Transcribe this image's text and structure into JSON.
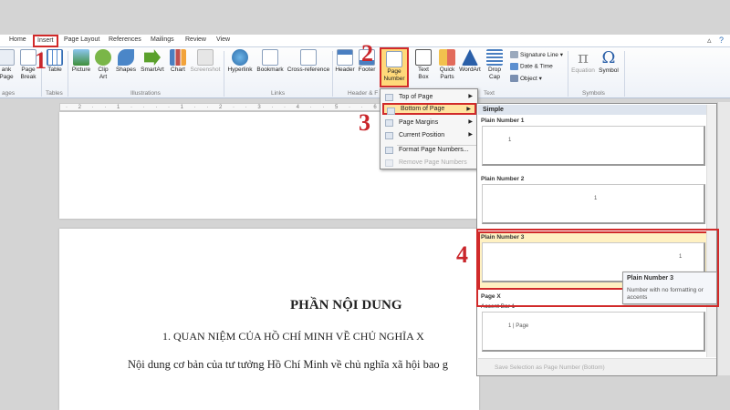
{
  "tabs": [
    "Home",
    "Insert",
    "Page Layout",
    "References",
    "Mailings",
    "Review",
    "View"
  ],
  "ribbon": {
    "blank_page": "ank Page",
    "page_break": "Page Break",
    "pages_group": "ages",
    "table": "Table",
    "tables_group": "Tables",
    "picture": "Picture",
    "clip_art": "Clip Art",
    "shapes": "Shapes",
    "smartart": "SmartArt",
    "chart": "Chart",
    "screenshot": "Screenshot",
    "illustrations_group": "Illustrations",
    "hyperlink": "Hyperlink",
    "bookmark": "Bookmark",
    "cross_reference": "Cross-reference",
    "links_group": "Links",
    "header": "Header",
    "footer": "Footer",
    "page_number": "Page Number",
    "header_footer_group": "Header & F",
    "text_box": "Text Box",
    "quick_parts": "Quick Parts",
    "wordart": "WordArt",
    "drop_cap": "Drop Cap",
    "text_group": "Text",
    "signature_line": "Signature Line",
    "date_time": "Date & Time",
    "object": "Object",
    "equation": "Equation",
    "symbol": "Symbol",
    "symbols_group": "Symbols"
  },
  "menu": {
    "items": [
      "Top of Page",
      "Bottom of Page",
      "Page Margins",
      "Current Position",
      "Format Page Numbers...",
      "Remove Page Numbers"
    ]
  },
  "gallery": {
    "header": "Simple",
    "items": [
      "Plain Number 1",
      "Plain Number 2",
      "Plain Number 3",
      "Page X",
      "Accent Bar 1"
    ],
    "sample_number": "1",
    "accent_sample": "1 | Page",
    "footer": "Save Selection as Page Number (Bottom)"
  },
  "tooltip": {
    "title": "Plain Number 3",
    "description": "Number with no formatting or accents"
  },
  "document": {
    "title": "PHẦN NỘI DUNG",
    "heading": "1.  QUAN NIỆM CỦA HỒ CHÍ MINH VỀ CHỦ NGHĨA X",
    "body": "Nội dung cơ bản của tư tưởng Hồ Chí Minh về chủ nghĩa xã hội bao g"
  },
  "ruler": "· 2 · · 1 · · · · 1 · · 2 · · 3 · · 4 · · 5 · · 6 · · 7 · · 8 · · 9 ·",
  "callouts": [
    "1",
    "2",
    "3",
    "4"
  ],
  "colors": {
    "accent_red": "#d12a2a",
    "highlight": "#ffe3a0"
  }
}
